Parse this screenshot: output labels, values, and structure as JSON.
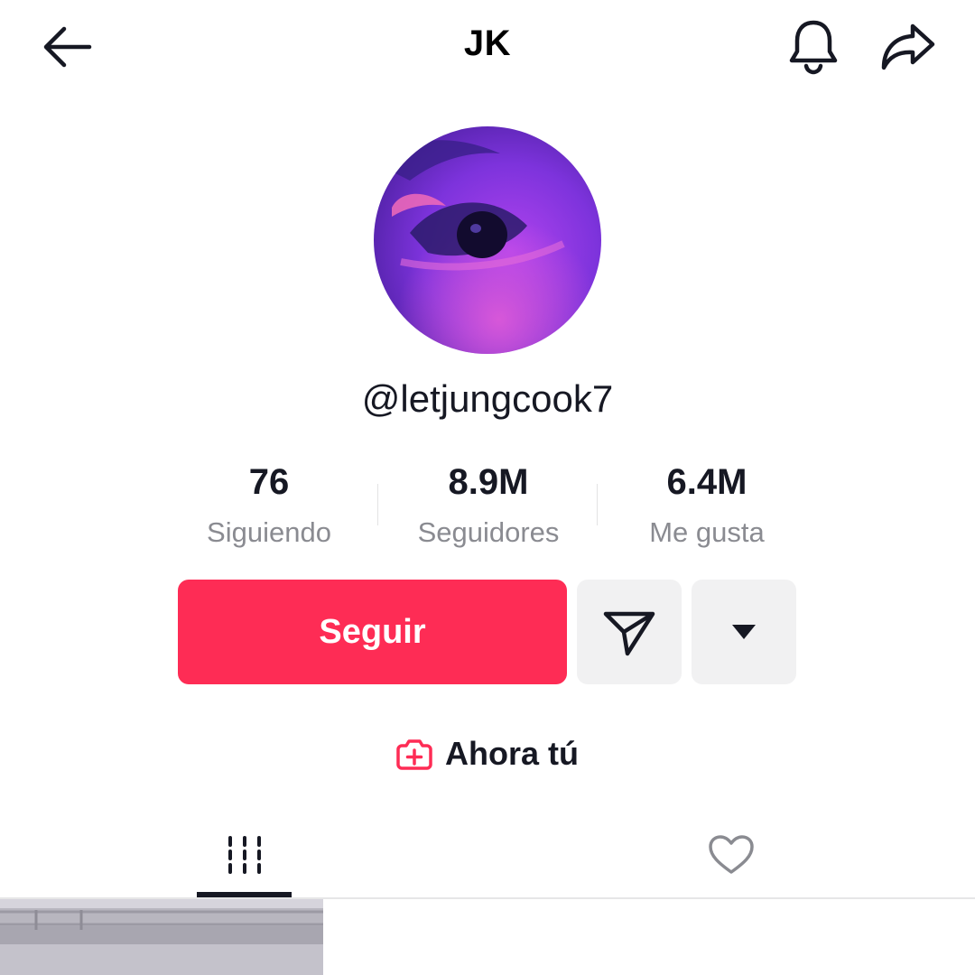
{
  "header": {
    "title": "JK",
    "back_icon": "arrow-left-icon",
    "bell_icon": "bell-icon",
    "share_icon": "share-arrow-icon"
  },
  "profile": {
    "username": "@letjungcook7",
    "avatar_description_colors": [
      "#6a2fd1",
      "#b43af0",
      "#f05ab0"
    ]
  },
  "stats": {
    "following": {
      "value": "76",
      "label": "Siguiendo"
    },
    "followers": {
      "value": "8.9M",
      "label": "Seguidores"
    },
    "likes": {
      "value": "6.4M",
      "label": "Me gusta"
    }
  },
  "actions": {
    "follow_label": "Seguir",
    "message_icon": "send-message-icon",
    "more_icon": "caret-down-icon"
  },
  "add_now": {
    "label": "Ahora tú",
    "icon": "add-camera-icon"
  },
  "tabs": [
    {
      "name": "videos",
      "icon": "grid-lines-icon",
      "active": true
    },
    {
      "name": "liked",
      "icon": "heart-icon",
      "active": false
    }
  ],
  "colors": {
    "accent": "#fe2c55",
    "text": "#161823",
    "muted": "#8a8b91",
    "button_bg": "#f1f1f2"
  }
}
